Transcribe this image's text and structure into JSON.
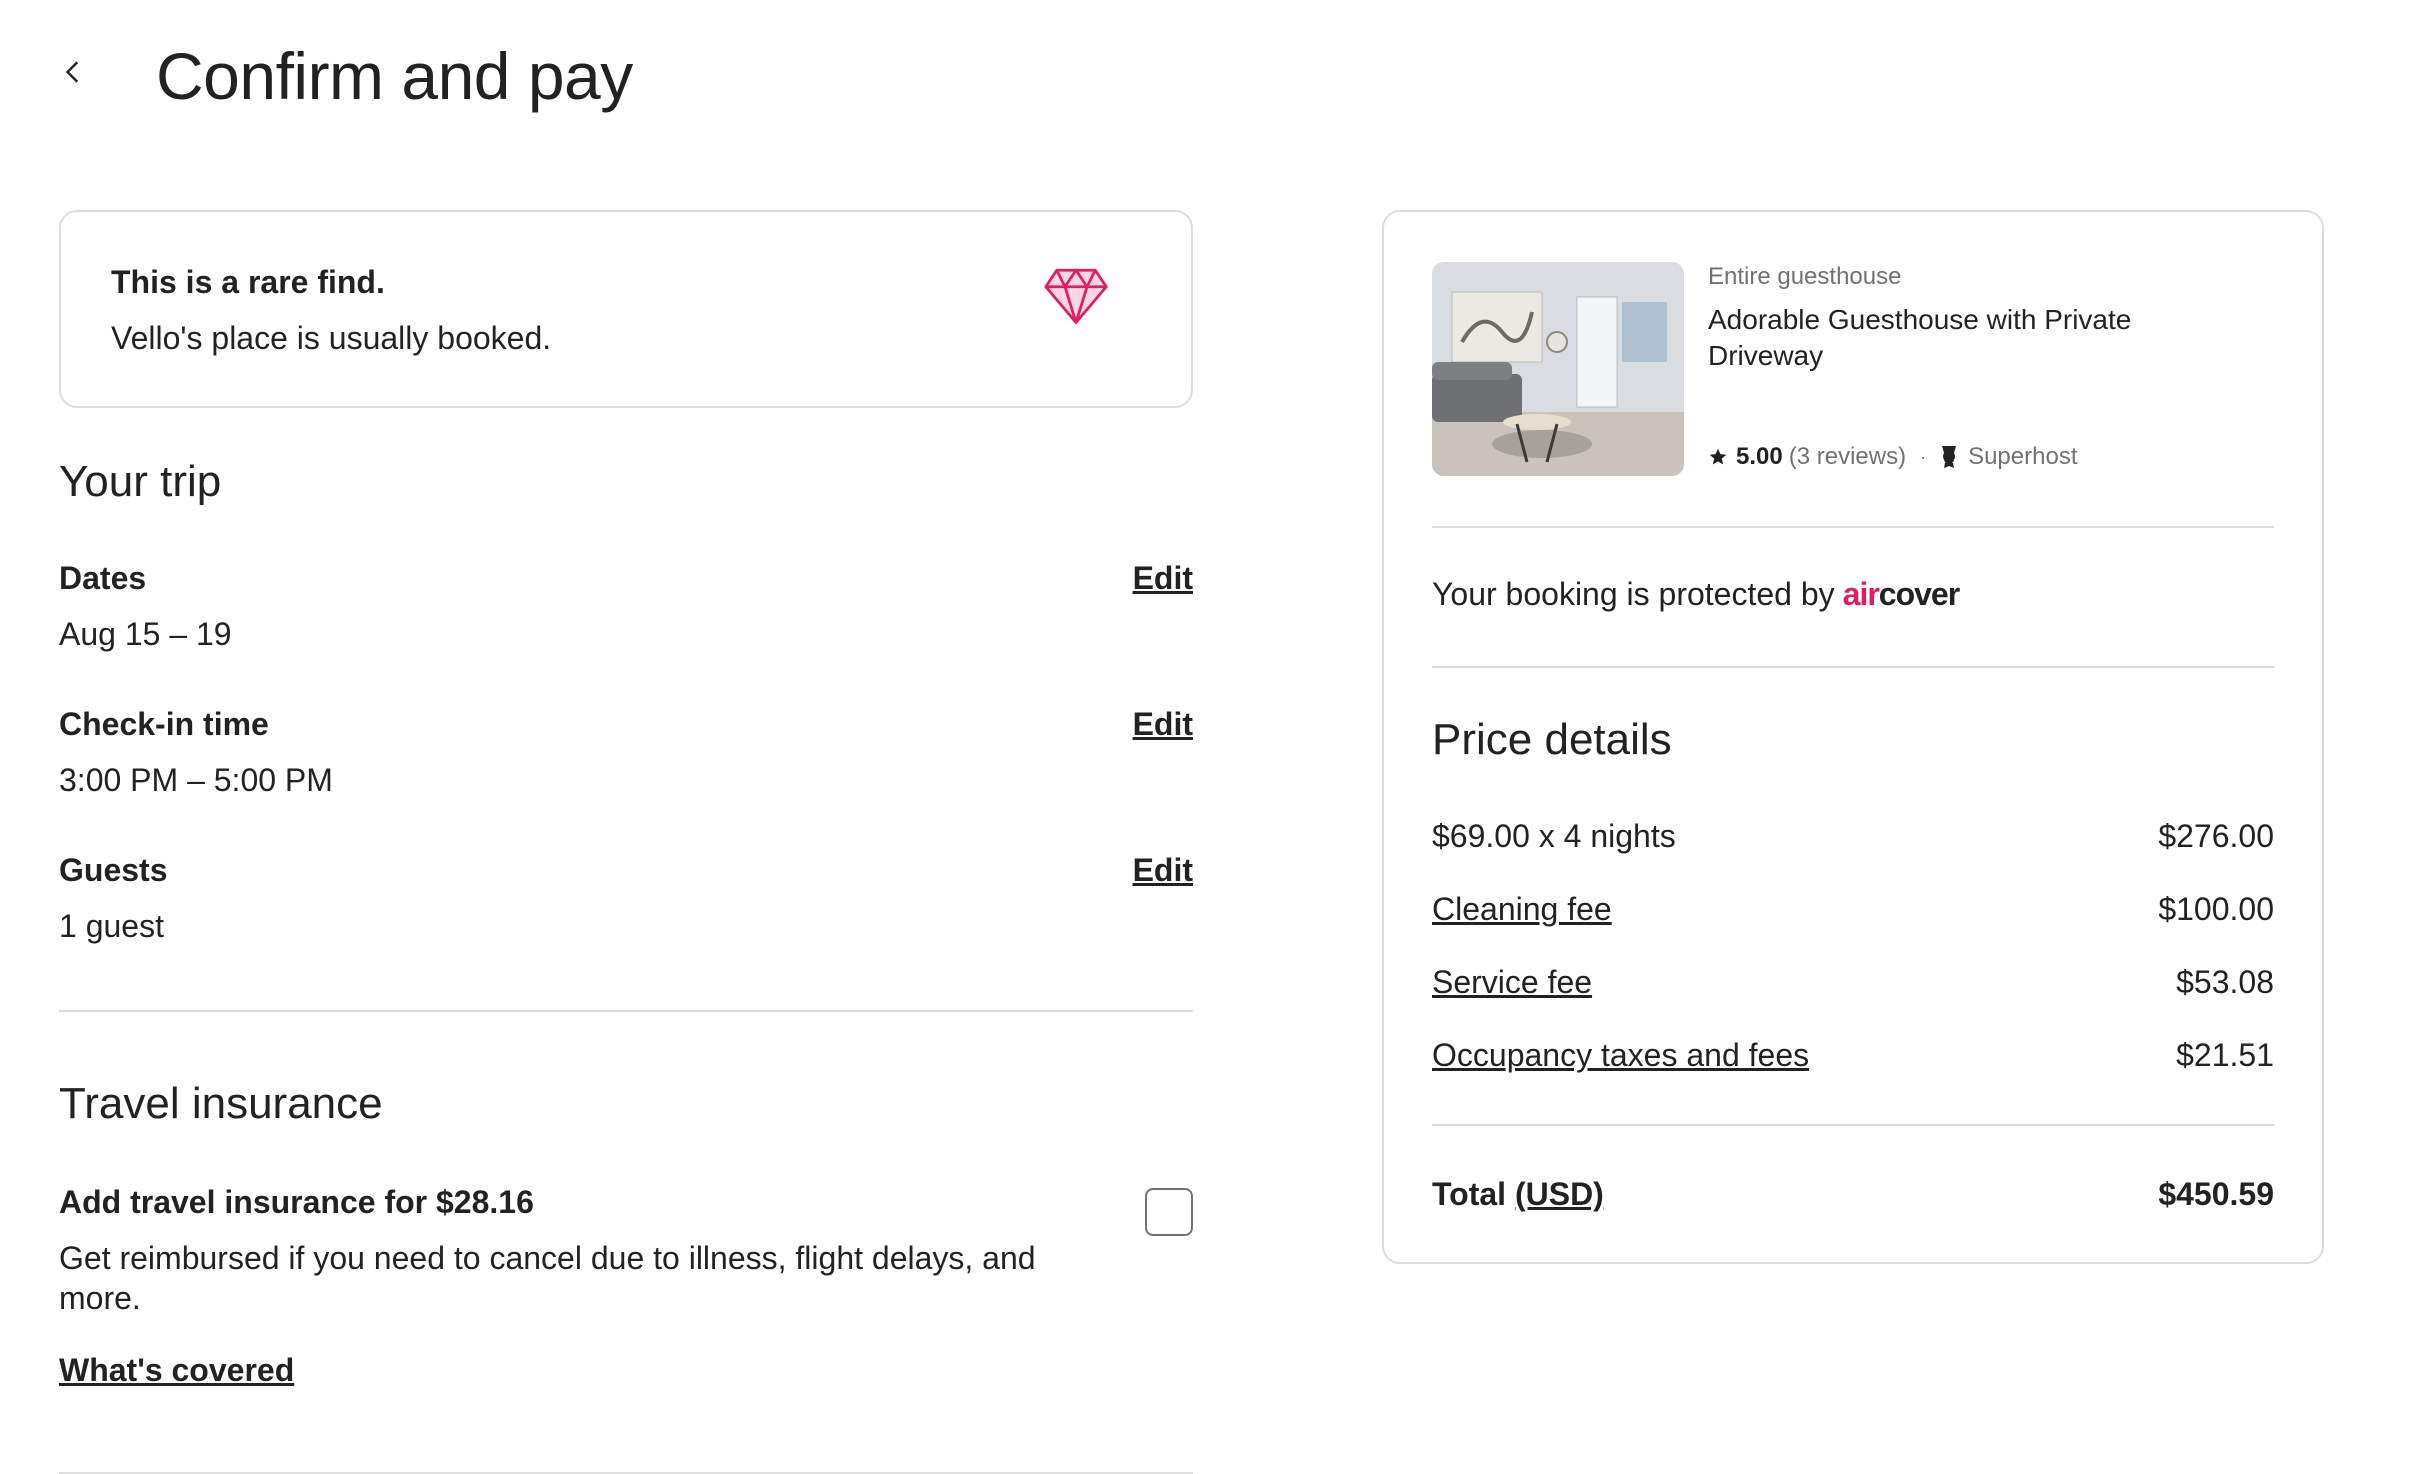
{
  "header": {
    "title": "Confirm and pay",
    "back_icon": "chevron-left-icon"
  },
  "rare_find": {
    "title": "This is a rare find.",
    "subtitle": "Vello's place is usually booked.",
    "icon": "diamond-icon",
    "icon_color": "#e31c5f"
  },
  "trip": {
    "title": "Your trip",
    "rows": [
      {
        "label": "Dates",
        "value": "Aug 15 – 19",
        "edit": "Edit"
      },
      {
        "label": "Check-in time",
        "value": "3:00 PM – 5:00 PM",
        "edit": "Edit"
      },
      {
        "label": "Guests",
        "value": "1 guest",
        "edit": "Edit"
      }
    ]
  },
  "insurance": {
    "title": "Travel insurance",
    "label": "Add travel insurance for $28.16",
    "description": "Get reimbursed if you need to cancel due to illness, flight delays, and more.",
    "link": "What's covered",
    "checked": false
  },
  "listing": {
    "type": "Entire guesthouse",
    "name": "Adorable Guesthouse with Private Driveway",
    "rating": "5.00",
    "reviews": "(3 reviews)",
    "separator": "·",
    "badge": "Superhost",
    "star_icon": "star-icon",
    "badge_icon": "superhost-icon"
  },
  "protection": {
    "text": "Your booking is protected by",
    "brand_air": "air",
    "brand_cover": "cover",
    "brand_color": "#e31c5f"
  },
  "price_details": {
    "title": "Price details",
    "rows": [
      {
        "label": "$69.00 x 4 nights",
        "amount": "$276.00"
      },
      {
        "label": "Cleaning fee",
        "amount": "$100.00"
      },
      {
        "label": "Service fee",
        "amount": "$53.08"
      },
      {
        "label": "Occupancy taxes and fees",
        "amount": "$21.51"
      }
    ],
    "total_label": "Total",
    "total_currency": "(USD)",
    "total_amount": "$450.59"
  }
}
